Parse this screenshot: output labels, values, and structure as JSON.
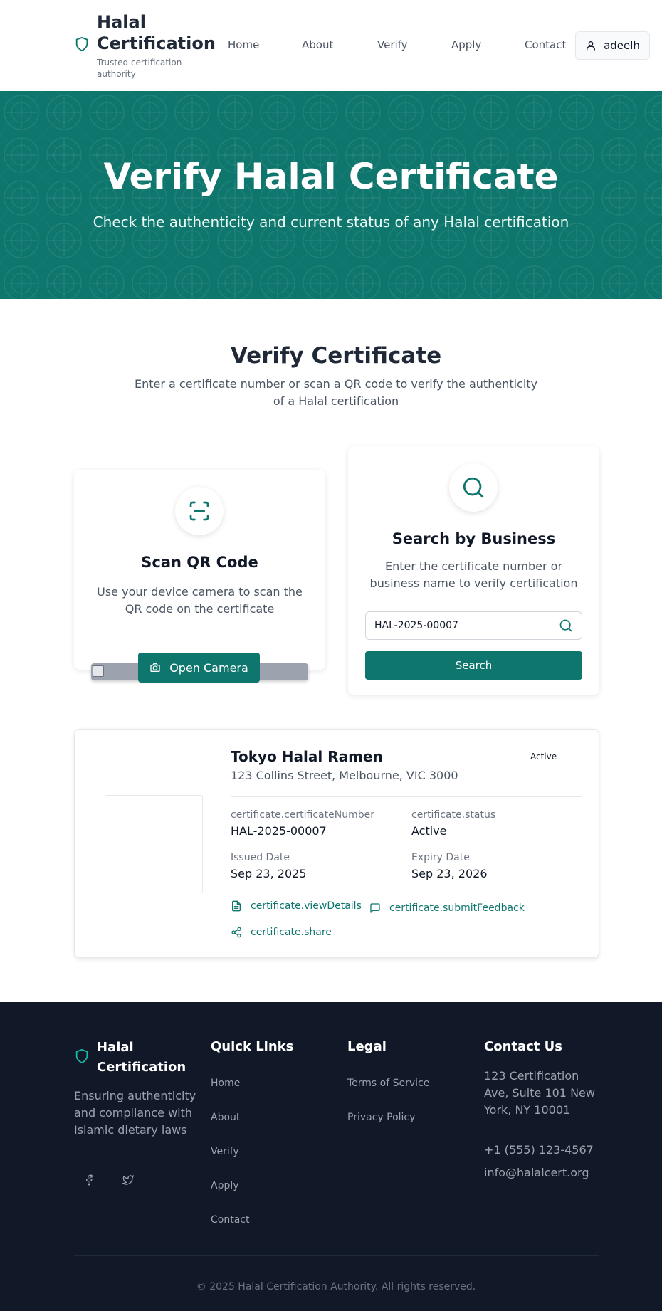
{
  "header": {
    "brand_title": "Halal Certification",
    "brand_subtitle": "Trusted certification authority",
    "nav": [
      "Home",
      "About",
      "Verify",
      "Apply",
      "Contact"
    ],
    "user": "adeelh"
  },
  "hero": {
    "title": "Verify Halal Certificate",
    "subtitle": "Check the authenticity and current status of any Halal certification"
  },
  "verify": {
    "title": "Verify Certificate",
    "subtitle": "Enter a certificate number or scan a QR code to verify the authenticity of a Halal certification",
    "qr_card": {
      "title": "Scan QR Code",
      "text": "Use your device camera to scan the QR code on the certificate",
      "button": "Open Camera"
    },
    "search_card": {
      "title": "Search by Business",
      "text": "Enter the certificate number or business name to verify certification",
      "input_value": "HAL-2025-00007",
      "button": "Search"
    }
  },
  "result": {
    "business_name": "Tokyo Halal Ramen",
    "address": "123 Collins Street, Melbourne, VIC 3000",
    "status_badge": "Active",
    "fields": {
      "cert_number_label": "certificate.certificateNumber",
      "cert_number_value": "HAL-2025-00007",
      "status_label": "certificate.status",
      "status_value": "Active",
      "issued_label": "Issued Date",
      "issued_value": "Sep 23, 2025",
      "expiry_label": "Expiry Date",
      "expiry_value": "Sep 23, 2026"
    },
    "actions": {
      "view_details": "certificate.viewDetails",
      "submit_feedback": "certificate.submitFeedback",
      "share": "certificate.share"
    }
  },
  "footer": {
    "brand_title": "Halal Certification",
    "description": "Ensuring authenticity and compliance with Islamic dietary laws",
    "quick_links_title": "Quick Links",
    "quick_links": [
      "Home",
      "About",
      "Verify",
      "Apply",
      "Contact"
    ],
    "legal_title": "Legal",
    "legal_links": [
      "Terms of Service",
      "Privacy Policy"
    ],
    "contact_title": "Contact Us",
    "contact_address": "123 Certification Ave, Suite 101 New York, NY 10001",
    "contact_phone": "+1 (555) 123-4567",
    "contact_email": "info@halalcert.org",
    "copyright": "© 2025 Halal Certification Authority. All rights reserved."
  },
  "colors": {
    "primary": "#0f766e",
    "footer_bg": "#111827"
  },
  "icons": [
    "shield-icon",
    "user-icon",
    "qr-scan-icon",
    "search-icon",
    "camera-icon",
    "file-text-icon",
    "message-square-icon",
    "share-icon",
    "facebook-icon",
    "twitter-icon"
  ]
}
